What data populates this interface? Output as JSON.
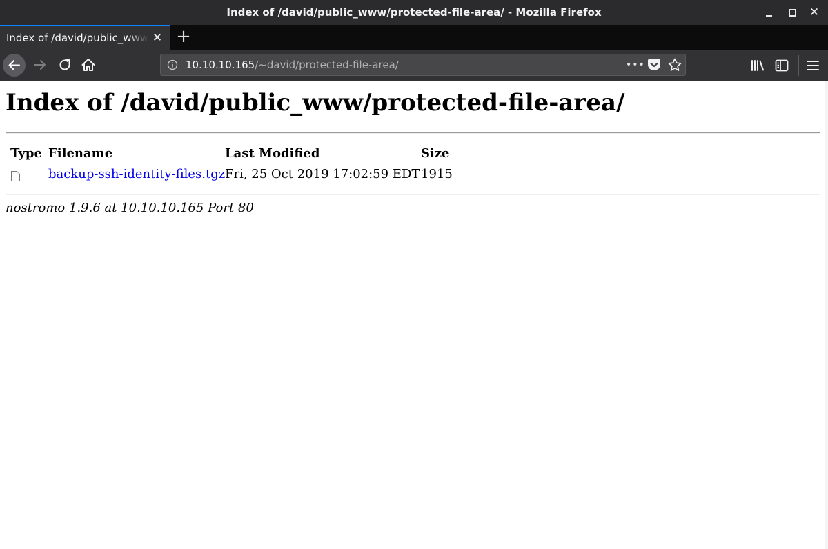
{
  "window": {
    "title": "Index of /david/public_www/protected-file-area/ - Mozilla Firefox",
    "minimize_glyph": "_",
    "maximize_glyph": "□",
    "close_glyph": "✕"
  },
  "tabs": [
    {
      "label": "Index of /david/public_www/protected-file-area/",
      "active": true,
      "close_glyph": "✕"
    }
  ],
  "tabstrip": {
    "new_tab_glyph": "+"
  },
  "navbar": {
    "url_host": "10.10.10.165",
    "url_path": "/~david/protected-file-area/",
    "page_actions_glyph": "•••",
    "icons": [
      "back-icon",
      "forward-icon",
      "reload-icon",
      "home-icon",
      "info-icon",
      "pocket-icon",
      "star-icon",
      "library-icon",
      "sidebar-icon",
      "menu-icon"
    ]
  },
  "page": {
    "heading": "Index of /david/public_www/protected-file-area/",
    "columns": {
      "type": "Type",
      "filename": "Filename",
      "modified": "Last Modified",
      "size": "Size"
    },
    "rows": [
      {
        "type_icon": "file-icon",
        "filename": "backup-ssh-identity-files.tgz",
        "modified": "Fri, 25 Oct 2019 17:02:59 EDT",
        "size": "1915"
      }
    ],
    "footer": "nostromo 1.9.6 at 10.10.10.165 Port 80"
  },
  "colors": {
    "titlebar_bg": "#2b2b2e",
    "toolbar_bg": "#323234",
    "tab_accent": "#0a84ff",
    "link": "#0000ee"
  }
}
